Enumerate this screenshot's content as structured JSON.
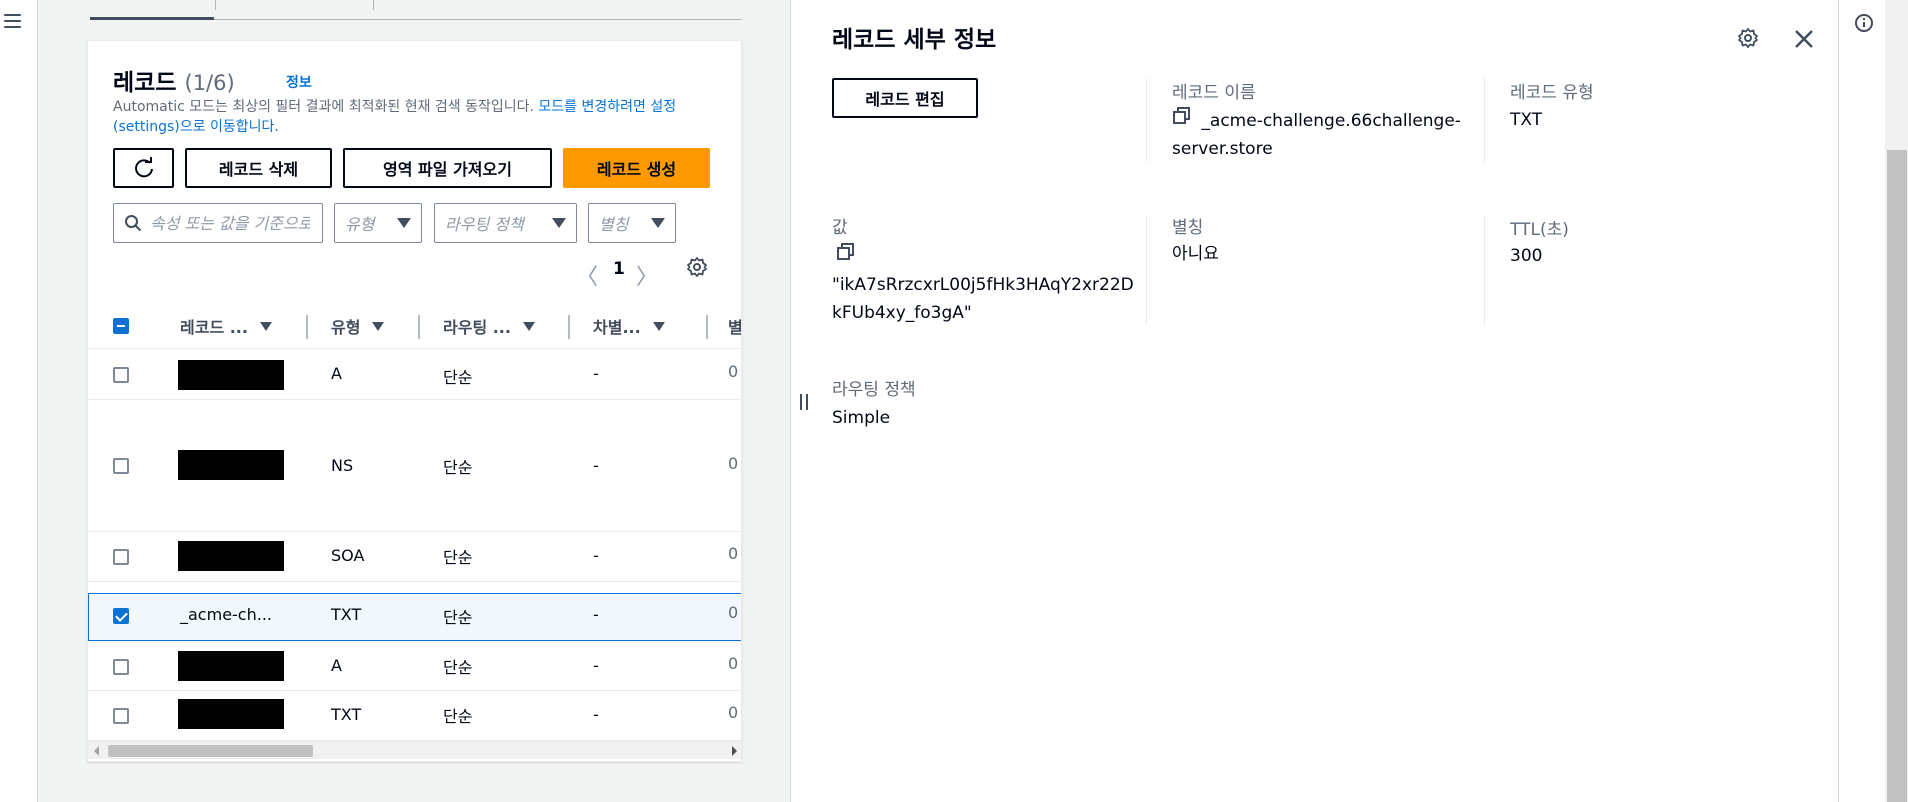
{
  "nav": {
    "menu_icon": "hamburger-menu-icon"
  },
  "records": {
    "title": "레코드",
    "count": "(1/6)",
    "info": "정보",
    "description_text": "Automatic 모드는 최상의 필터 결과에 최적화된 현재 검색 동작입니다. ",
    "description_link": "모드를 변경하려면 설정(settings)으로 이동합니다.",
    "buttons": {
      "refresh_icon": "refresh-icon",
      "delete": "레코드 삭제",
      "import": "영역 파일 가져오기",
      "create": "레코드 생성"
    },
    "filter": {
      "placeholder": "속성 또는 값을 기준으로 레코드 필터링"
    },
    "selects": {
      "type": "유형",
      "routing": "라우팅 정책",
      "alias": "별칭"
    },
    "pagination": {
      "prev": "〈",
      "page": "1",
      "next": "〉"
    },
    "columns": [
      "레코드 ...",
      "유형",
      "라우팅 ...",
      "차별...",
      "별"
    ],
    "rows": [
      {
        "name": "",
        "type": "A",
        "routing": "단순",
        "diff": "-",
        "alias": "0",
        "redacted": true,
        "checked": false
      },
      {
        "name": "",
        "type": "NS",
        "routing": "단순",
        "diff": "-",
        "alias": "0",
        "redacted": true,
        "checked": false
      },
      {
        "name": "",
        "type": "SOA",
        "routing": "단순",
        "diff": "-",
        "alias": "0",
        "redacted": true,
        "checked": false
      },
      {
        "name": "_acme-ch...",
        "type": "TXT",
        "routing": "단순",
        "diff": "-",
        "alias": "0",
        "redacted": false,
        "checked": true
      },
      {
        "name": "",
        "type": "A",
        "routing": "단순",
        "diff": "-",
        "alias": "0",
        "redacted": true,
        "checked": false
      },
      {
        "name": "",
        "type": "TXT",
        "routing": "단순",
        "diff": "-",
        "alias": "0",
        "redacted": true,
        "checked": false
      }
    ]
  },
  "details": {
    "title": "레코드 세부 정보",
    "edit_button": "레코드 편집",
    "record_name_label": "레코드 이름",
    "record_name_line1": "_acme-challenge.66challenge-",
    "record_name_line2": "server.store",
    "record_type_label": "레코드 유형",
    "record_type": "TXT",
    "value_label": "값",
    "value_line1": "\"ikA7sRrzcxrL00j5fHk3HAqY2xr22D",
    "value_line2": "kFUb4xy_fo3gA\"",
    "alias_label": "별칭",
    "alias": "아니요",
    "ttl_label": "TTL(초)",
    "ttl": "300",
    "routing_label": "라우팅 정책",
    "routing": "Simple"
  },
  "colors": {
    "accent": "#0972d3",
    "primary_button": "#ff9900",
    "text": "#000716",
    "muted": "#5f6b7a"
  }
}
